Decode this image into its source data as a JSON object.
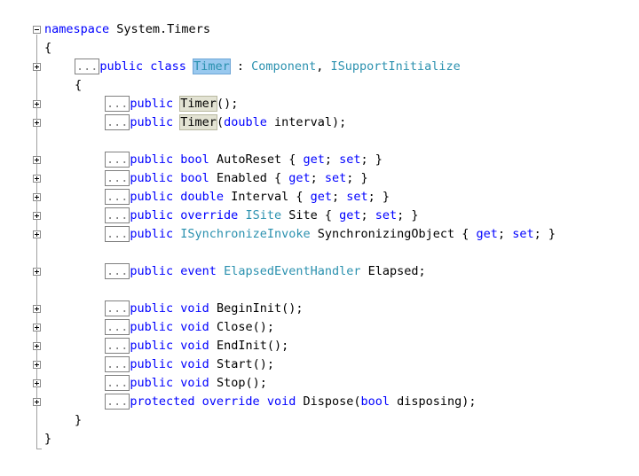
{
  "colors": {
    "keyword": "#0000ff",
    "type": "#2b91af",
    "text": "#000000",
    "selection": "#99c9ef",
    "reference_highlight": "#e3e3d3"
  },
  "collapsed_marker": "...",
  "code": {
    "namespace_kw": "namespace",
    "namespace_name": " System.Timers",
    "open_brace_ns": "{",
    "close_brace_ns": "}",
    "class_decl": {
      "modifiers": "public class ",
      "name": "Timer",
      "sep": " : ",
      "base1": "Component",
      "comma": ", ",
      "base2": "ISupportInitialize"
    },
    "open_brace_class": "{",
    "close_brace_class": "}",
    "ctor1": {
      "kw": "public ",
      "name": "Timer",
      "rest": "();"
    },
    "ctor2": {
      "kw": "public ",
      "name": "Timer",
      "paren": "(",
      "ptype": "double",
      "rest": " interval);"
    },
    "prop_autoreset": {
      "kw": "public bool ",
      "name": "AutoReset { ",
      "get": "get",
      "semi1": "; ",
      "set": "set",
      "end": "; }"
    },
    "prop_enabled": {
      "kw": "public bool ",
      "name": "Enabled { ",
      "get": "get",
      "semi1": "; ",
      "set": "set",
      "end": "; }"
    },
    "prop_interval": {
      "kw": "public double ",
      "name": "Interval { ",
      "get": "get",
      "semi1": "; ",
      "set": "set",
      "end": "; }"
    },
    "prop_site": {
      "kw": "public override ",
      "type": "ISite",
      "name": " Site { ",
      "get": "get",
      "semi1": "; ",
      "set": "set",
      "end": "; }"
    },
    "prop_sync": {
      "kw": "public ",
      "type": "ISynchronizeInvoke",
      "name": " SynchronizingObject { ",
      "get": "get",
      "semi1": "; ",
      "set": "set",
      "end": "; }"
    },
    "event_elapsed": {
      "kw": "public event ",
      "type": "ElapsedEventHandler",
      "name": " Elapsed;"
    },
    "m_begininit": {
      "kw": "public void ",
      "name": "BeginInit();"
    },
    "m_close": {
      "kw": "public void ",
      "name": "Close();"
    },
    "m_endinit": {
      "kw": "public void ",
      "name": "EndInit();"
    },
    "m_start": {
      "kw": "public void ",
      "name": "Start();"
    },
    "m_stop": {
      "kw": "public void ",
      "name": "Stop();"
    },
    "m_dispose": {
      "kw": "protected override void ",
      "name": "Dispose(",
      "ptype": "bool",
      "rest": " disposing);"
    }
  }
}
